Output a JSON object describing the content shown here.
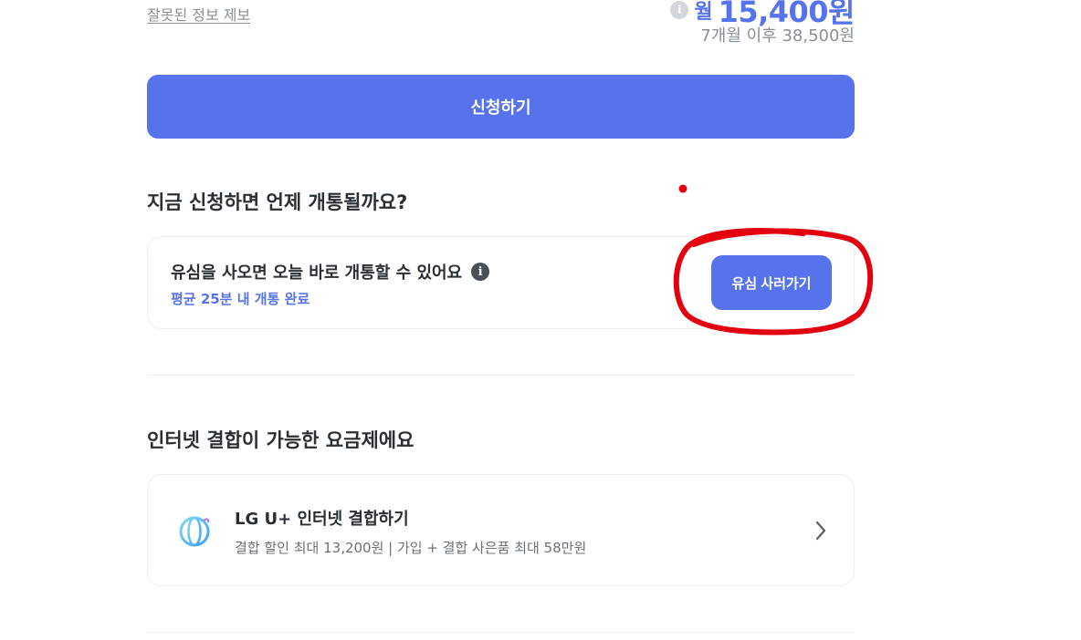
{
  "top": {
    "report_link": "잘못된 정보 제보",
    "price_prefix": "월",
    "price_amount": "15,400원",
    "price_after": "7개월 이후 38,500원"
  },
  "apply_button": "신청하기",
  "activation": {
    "section_title": "지금 신청하면 언제 개통될까요?",
    "headline": "유심을 사오면 오늘 바로 개통할 수 있어요",
    "sub": "평균 25분 내 개통 완료",
    "button": "유심 사러가기",
    "info_glyph": "i"
  },
  "internet": {
    "section_title": "인터넷 결합이 가능한 요금제에요",
    "title": "LG U+ 인터넷 결합하기",
    "desc": "결합 할인 최대 13,200원 | 가입 + 결합 사은품 최대 58만원",
    "icon": "globe-icon"
  },
  "colors": {
    "accent": "#5673eb",
    "annotation": "#e3000f"
  }
}
